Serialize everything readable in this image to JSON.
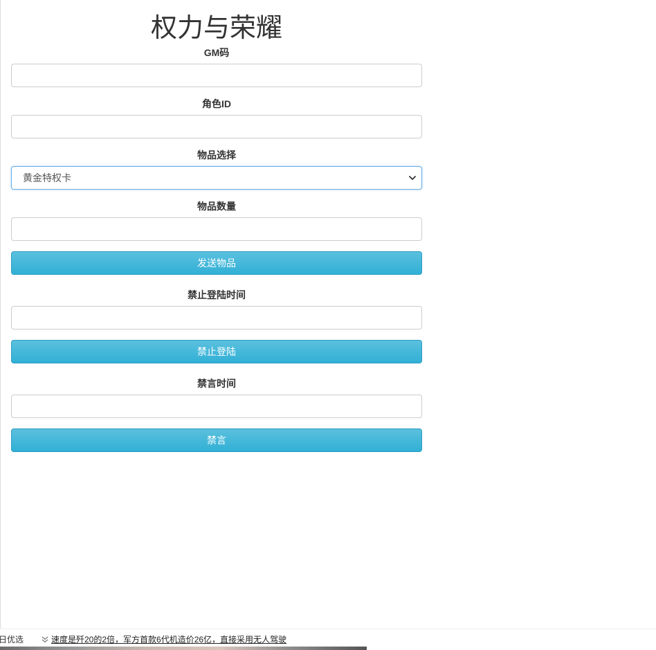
{
  "page": {
    "title": "权力与荣耀"
  },
  "form": {
    "gm_code": {
      "label": "GM码",
      "value": "",
      "placeholder": ""
    },
    "role_id": {
      "label": "角色ID",
      "value": "",
      "placeholder": ""
    },
    "item_select": {
      "label": "物品选择",
      "selected": "黄金特权卡"
    },
    "item_quantity": {
      "label": "物品数量",
      "value": "",
      "placeholder": ""
    },
    "send_item_button": "发送物品",
    "ban_login_time": {
      "label": "禁止登陆时间",
      "value": "",
      "placeholder": ""
    },
    "ban_login_button": "禁止登陆",
    "mute_time": {
      "label": "禁言时间",
      "value": "",
      "placeholder": ""
    },
    "mute_button": "禁言"
  },
  "bottom_bar": {
    "left_text": "日优选",
    "news_icon": "chevron-double-down-icon",
    "news_link": "速度是歼20的2倍，军方首款6代机造价26亿，直接采用无人驾驶"
  },
  "colors": {
    "button_bg": "#5bc0de",
    "button_border": "#2a9cc3",
    "focus_border": "#66afe9"
  }
}
